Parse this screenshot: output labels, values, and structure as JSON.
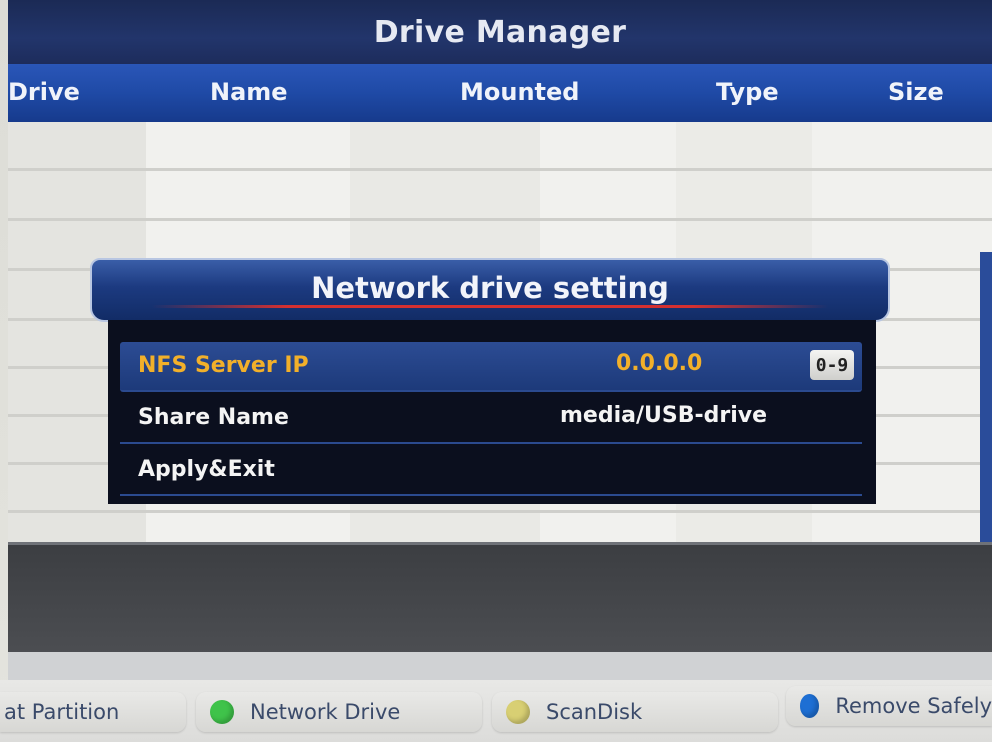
{
  "header": {
    "title": "Drive Manager"
  },
  "table": {
    "columns": [
      "Drive",
      "Name",
      "Mounted",
      "Type",
      "Size"
    ]
  },
  "dialog": {
    "title": "Network drive setting",
    "rows": [
      {
        "label": "NFS Server IP",
        "value": "0.0.0.0",
        "hint": "0-9",
        "selected": true
      },
      {
        "label": "Share Name",
        "value": "media/USB-drive",
        "selected": false
      },
      {
        "label": "Apply&Exit",
        "value": "",
        "selected": false
      }
    ]
  },
  "footer": {
    "buttons": [
      {
        "label": "at Partition",
        "color": ""
      },
      {
        "label": "Network Drive",
        "color": "#3fc34a"
      },
      {
        "label": "ScanDisk",
        "color": "#d8cf73"
      },
      {
        "label": "Remove Safely",
        "color": "#1e6fd4"
      }
    ]
  },
  "colors": {
    "title_bar": "#1b2a55",
    "header_bar": "#1f4aa6",
    "selected_text": "#f2b02a"
  }
}
